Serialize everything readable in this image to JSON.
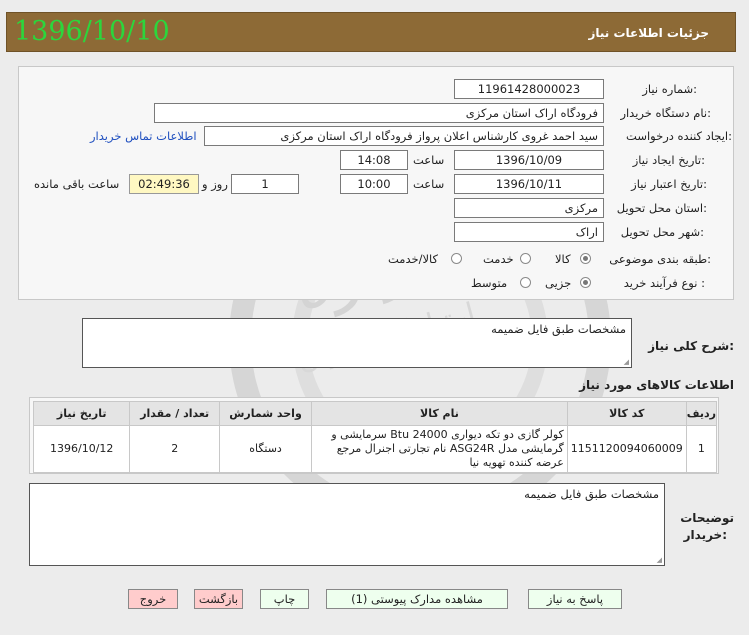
{
  "header": {
    "title": "جزئیات اطلاعات نیاز",
    "date_overlay": "1396/10/10"
  },
  "form": {
    "need_number_label": "شماره نیاز:",
    "need_number": "11961428000023",
    "buyer_label": "نام دستگاه خریدار:",
    "buyer": "فرودگاه اراک استان مرکزی",
    "creator_label": "ایجاد کننده درخواست:",
    "creator": "سید احمد غروی کارشناس اعلان پرواز فرودگاه اراک استان مرکزی",
    "contact_link": "اطلاعات تماس خریدار",
    "created_label": "تاریخ ایجاد نیاز:",
    "created_date": "1396/10/09",
    "time_label": "ساعت",
    "created_time": "14:08",
    "validity_label": "تاریخ اعتبار نیاز:",
    "validity_date": "1396/10/11",
    "validity_time": "10:00",
    "days_value": "1",
    "days_label": "روز و",
    "remaining_time": "02:49:36",
    "remaining_label": "ساعت باقی مانده",
    "province_label": "استان محل تحویل:",
    "province": "مرکزی",
    "city_label": "شهر محل تحویل:",
    "city": "اراک",
    "category_label": "طبقه بندی موضوعی:",
    "cat_goods": "کالا",
    "cat_service": "خدمت",
    "cat_both": "کالا/خدمت",
    "process_label": "نوع فرآیند خرید :",
    "proc_partial": "جزیی",
    "proc_medium": "متوسط"
  },
  "summary": {
    "label": "شرح کلی نیاز:",
    "text": "مشخصات طبق فایل ضمیمه"
  },
  "goods": {
    "title": "اطلاعات کالاهای مورد نیاز",
    "columns": [
      "ردیف",
      "کد کالا",
      "نام کالا",
      "واحد شمارش",
      "تعداد / مقدار",
      "تاریخ نیاز"
    ],
    "rows": [
      {
        "index": "1",
        "code": "1151120094060009",
        "name": "کولر گازی دو تکه دیواری Btu 24000 سرمایشی و گرمایشی مدل ASG24R نام تجارتی اجنرال مرجع عرضه کننده تهویه نیا",
        "unit": "دستگاه",
        "qty": "2",
        "date": "1396/10/12"
      }
    ]
  },
  "buyer_notes": {
    "label1": "توضیحات",
    "label2": "خریدار:",
    "text": "مشخصات طبق فایل ضمیمه"
  },
  "buttons": {
    "reply": "پاسخ به نیاز",
    "attachments": "مشاهده مدارک پیوستی (1)",
    "print": "چاپ",
    "back": "بازگشت",
    "exit": "خروج"
  },
  "watermark": {
    "main": "هزاره",
    "sub": "ارتباط گستران"
  }
}
